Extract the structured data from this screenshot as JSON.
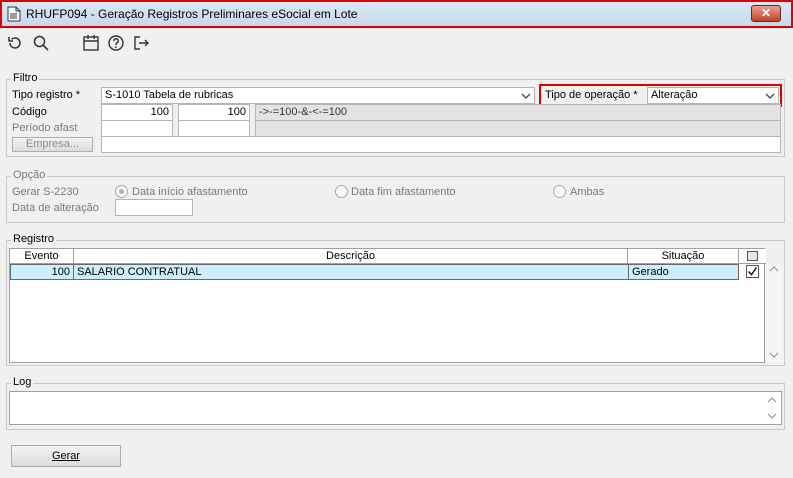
{
  "window": {
    "title": "RHUFP094 - Geração Registros Preliminares eSocial em Lote",
    "close_glyph": "✕"
  },
  "toolbar": {
    "icons": [
      "refresh-icon",
      "search-icon",
      "calendar-icon",
      "help-icon",
      "exit-icon"
    ]
  },
  "filtro": {
    "legend": "Filtro",
    "tipo_registro_label": "Tipo registro *",
    "tipo_registro_value": "S-1010 Tabela de rubricas",
    "tipo_operacao_label": "Tipo de operação *",
    "tipo_operacao_value": "Alteração",
    "codigo_label": "Código",
    "codigo_from": "100",
    "codigo_to": "100",
    "codigo_expr": "->-=100-&-<-=100",
    "periodo_label": "Período afast",
    "empresa_button": "Empresa..."
  },
  "opcao": {
    "legend": "Opção",
    "gerar_label": "Gerar S-2230",
    "radio_inicio": "Data início afastamento",
    "radio_fim": "Data fim afastamento",
    "radio_ambas": "Ambas",
    "data_alteracao_label": "Data de alteração",
    "data_alteracao_value": ""
  },
  "registro": {
    "legend": "Registro",
    "columns": [
      "Evento",
      "Descrição",
      "Situação"
    ],
    "rows": [
      {
        "evento": "100",
        "descricao": "SALARIO CONTRATUAL",
        "situacao": "Gerado",
        "checked": true
      }
    ]
  },
  "log": {
    "legend": "Log",
    "content": ""
  },
  "footer": {
    "gerar_button": "Gerar"
  },
  "colors": {
    "highlight_border": "#e00000",
    "selected_row": "#cdeefb"
  }
}
